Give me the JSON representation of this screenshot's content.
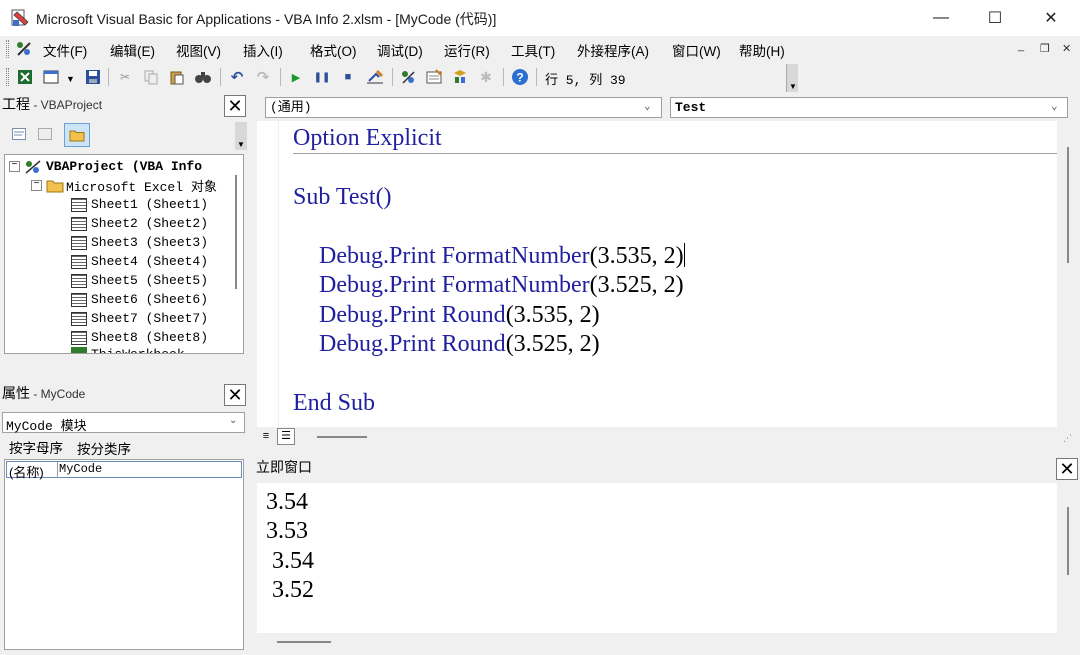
{
  "window": {
    "title": "Microsoft Visual Basic for Applications - VBA Info 2.xlsm - [MyCode (代码)]",
    "minimize": "—",
    "maximize": "☐",
    "close": "✕"
  },
  "menu": {
    "items": [
      "文件(F)",
      "编辑(E)",
      "视图(V)",
      "插入(I)",
      "格式(O)",
      "调试(D)",
      "运行(R)",
      "工具(T)",
      "外接程序(A)",
      "窗口(W)",
      "帮助(H)"
    ],
    "mdi_minimize": "_",
    "mdi_restore": "❐",
    "mdi_close": "✕"
  },
  "toolbar": {
    "position": "行 5, 列 39"
  },
  "project_panel": {
    "title": "工程",
    "subtitle": "VBAProject",
    "root": "VBAProject (VBA Info",
    "folder": "Microsoft Excel 对象",
    "sheets": [
      "Sheet1 (Sheet1)",
      "Sheet2 (Sheet2)",
      "Sheet3 (Sheet3)",
      "Sheet4 (Sheet4)",
      "Sheet5 (Sheet5)",
      "Sheet6 (Sheet6)",
      "Sheet7 (Sheet7)",
      "Sheet8 (Sheet8)"
    ],
    "partial_item": "ThisWorkbook"
  },
  "properties_panel": {
    "title": "属性",
    "subtitle": "MyCode",
    "object": "MyCode 模块",
    "tab_alpha": "按字母序",
    "tab_category": "按分类序",
    "prop_name": "(名称)",
    "prop_value": "MyCode"
  },
  "code_window": {
    "object_combo": "(通用)",
    "proc_combo": "Test",
    "lines": [
      {
        "kw": "Option Explicit",
        "rest": ""
      },
      {
        "kw": "Sub ",
        "rest": ""
      },
      {
        "obj": "Debug.Print ",
        "fn": "FormatNumber",
        "args": "(3.535, 2)"
      },
      {
        "obj": "Debug.Print ",
        "fn": "FormatNumber",
        "args": "(3.525, 2)"
      },
      {
        "obj": "Debug.Print ",
        "fn": "Round",
        "args": "(3.535, 2)"
      },
      {
        "obj": "Debug.Print ",
        "fn": "Round",
        "args": "(3.525, 2)"
      },
      {
        "kw": "End Sub",
        "rest": ""
      }
    ],
    "sub_name": "Test()"
  },
  "immediate_window": {
    "title": "立即窗口",
    "outputs": [
      "3.54",
      "3.53",
      " 3.54",
      " 3.52"
    ]
  },
  "colors": {
    "keyword": "#1f1fa0",
    "background": "#f0f0f0"
  }
}
